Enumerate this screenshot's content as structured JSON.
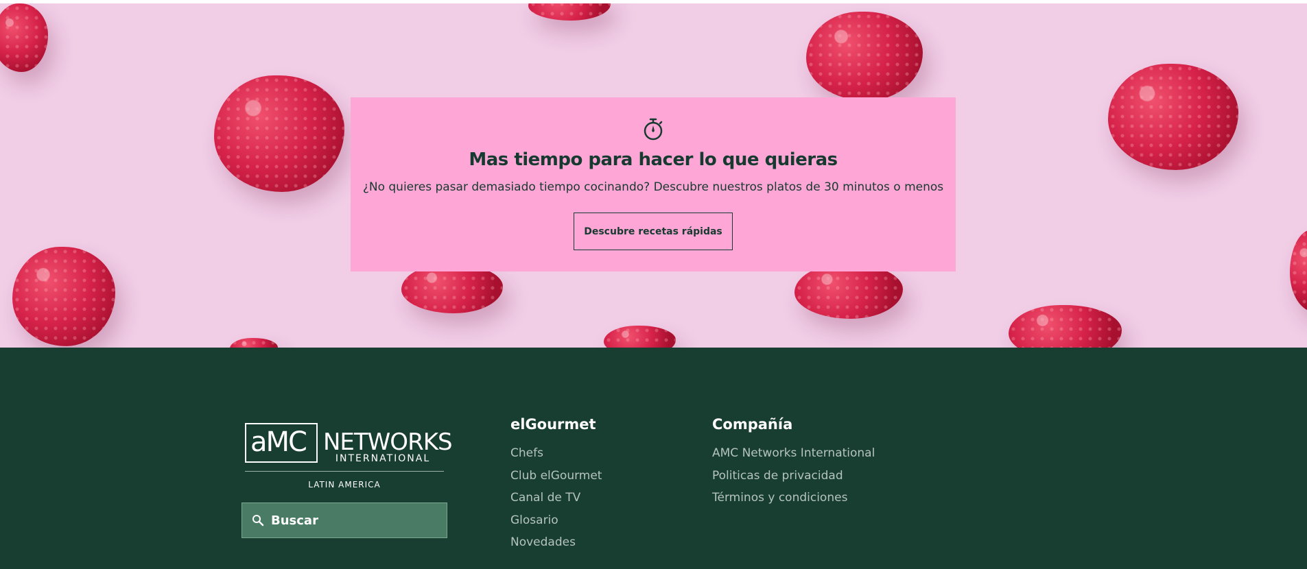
{
  "promo": {
    "icon": "stopwatch-icon",
    "title": "Mas tiempo para hacer lo que quieras",
    "subtitle": "¿No quieres pasar demasiado tiempo cocinando? Descubre nuestros platos de 30 minutos o menos",
    "button_label": "Descubre recetas rápidas",
    "background_color": "#fea6d6",
    "text_color": "#163a2f"
  },
  "hero": {
    "image": "raspberries-on-pink-background",
    "background_color": "#f1cde6"
  },
  "footer": {
    "background_color": "#183d31",
    "logo": {
      "brand_amc": "aMC",
      "brand_networks": "NETWORKS",
      "brand_international": "INTERNATIONAL",
      "region": "LATIN AMERICA"
    },
    "search": {
      "icon": "search-icon",
      "label": "Buscar"
    },
    "columns": [
      {
        "heading": "elGourmet",
        "links": [
          "Chefs",
          "Club elGourmet",
          "Canal de TV",
          "Glosario",
          "Novedades"
        ]
      },
      {
        "heading": "Compañía",
        "links": [
          "AMC Networks International",
          "Politicas de privacidad",
          "Términos y condiciones"
        ]
      }
    ]
  }
}
